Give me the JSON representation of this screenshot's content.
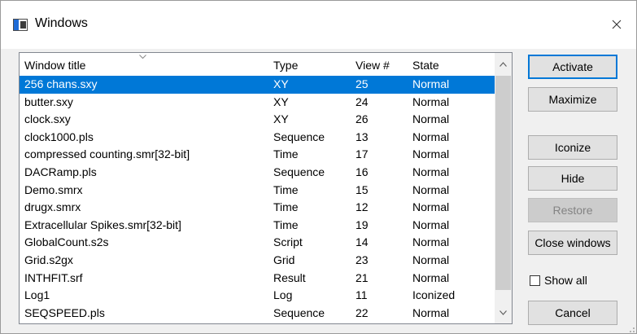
{
  "window": {
    "title": "Windows"
  },
  "list": {
    "columns": [
      "Window title",
      "Type",
      "View #",
      "State"
    ],
    "rows": [
      {
        "title": "256 chans.sxy",
        "type": "XY",
        "view": "25",
        "state": "Normal",
        "selected": true
      },
      {
        "title": "butter.sxy",
        "type": "XY",
        "view": "24",
        "state": "Normal"
      },
      {
        "title": "clock.sxy",
        "type": "XY",
        "view": "26",
        "state": "Normal"
      },
      {
        "title": "clock1000.pls",
        "type": "Sequence",
        "view": "13",
        "state": "Normal"
      },
      {
        "title": "compressed counting.smr[32-bit]",
        "type": "Time",
        "view": "17",
        "state": "Normal"
      },
      {
        "title": "DACRamp.pls",
        "type": "Sequence",
        "view": "16",
        "state": "Normal"
      },
      {
        "title": "Demo.smrx",
        "type": "Time",
        "view": "15",
        "state": "Normal"
      },
      {
        "title": "drugx.smrx",
        "type": "Time",
        "view": "12",
        "state": "Normal"
      },
      {
        "title": "Extracellular Spikes.smr[32-bit]",
        "type": "Time",
        "view": "19",
        "state": "Normal"
      },
      {
        "title": "GlobalCount.s2s",
        "type": "Script",
        "view": "14",
        "state": "Normal"
      },
      {
        "title": "Grid.s2gx",
        "type": "Grid",
        "view": "23",
        "state": "Normal"
      },
      {
        "title": "INTHFIT.srf",
        "type": "Result",
        "view": "21",
        "state": "Normal"
      },
      {
        "title": "Log1",
        "type": "Log",
        "view": "11",
        "state": "Iconized"
      },
      {
        "title": "SEQSPEED.pls",
        "type": "Sequence",
        "view": "22",
        "state": "Normal"
      }
    ]
  },
  "buttons": {
    "activate": "Activate",
    "maximize": "Maximize",
    "iconize": "Iconize",
    "hide": "Hide",
    "restore": "Restore",
    "close_windows": "Close windows",
    "cancel": "Cancel"
  },
  "show_all": {
    "label": "Show all",
    "checked": false
  },
  "colors": {
    "selection": "#0078d7",
    "default_button_border": "#0078d7"
  }
}
